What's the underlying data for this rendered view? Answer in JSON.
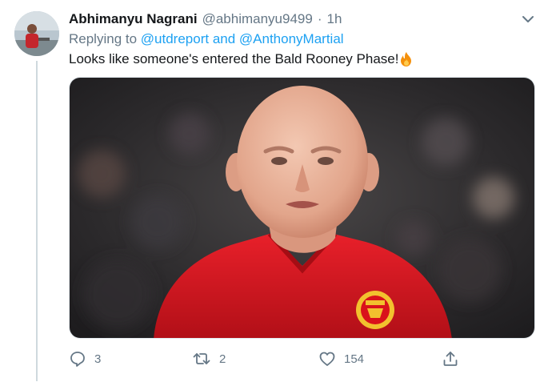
{
  "tweet": {
    "author_name": "Abhimanyu Nagrani",
    "handle": "@abhimanyu9499",
    "separator": "·",
    "time": "1h",
    "replying_prefix": "Replying to ",
    "reply_mention_1": "@utdreport",
    "reply_connector": " and ",
    "reply_mention_2": "@AnthonyMartial",
    "text": "Looks like someone's entered the Bald Rooney Phase!",
    "text_emoji": "fire-emoji",
    "media_description": "photo"
  },
  "actions": {
    "reply_count": "3",
    "retweet_count": "2",
    "like_count": "154"
  },
  "colors": {
    "link": "#1da1f2",
    "secondary_text": "#657786",
    "primary_text": "#14171a",
    "jersey_red": "#d9121b",
    "crest_gold": "#f2c12e"
  },
  "icons": [
    "caret-down-icon",
    "reply-icon",
    "retweet-icon",
    "like-icon",
    "share-icon"
  ]
}
